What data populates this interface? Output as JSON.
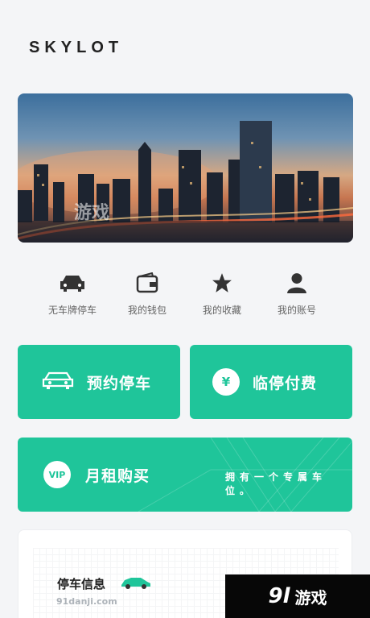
{
  "brand": "SKYLOT",
  "quick_actions": [
    {
      "label": "无车牌停车",
      "icon": "car-icon"
    },
    {
      "label": "我的钱包",
      "icon": "wallet-icon"
    },
    {
      "label": "我的收藏",
      "icon": "star-icon"
    },
    {
      "label": "我的账号",
      "icon": "user-icon"
    }
  ],
  "cards": {
    "reserve": {
      "label": "预约停车",
      "icon": "car-outline-icon"
    },
    "pay": {
      "label": "临停付费",
      "icon": "yen-icon",
      "glyph": "¥"
    },
    "monthly": {
      "label": "月租购买",
      "icon": "vip-icon",
      "badge": "VIP",
      "subtitle": "拥有一个专属车位。"
    }
  },
  "parking_info": {
    "title": "停车信息"
  },
  "watermark": {
    "logo": "9l",
    "text": "游戏",
    "site": "91danji.com"
  },
  "colors": {
    "accent": "#1fc59a",
    "background": "#f4f5f7"
  }
}
